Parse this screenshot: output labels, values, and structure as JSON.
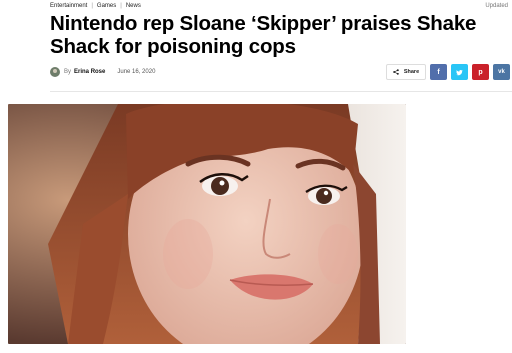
{
  "breadcrumb": [
    "Entertainment",
    "Games",
    "News"
  ],
  "updated_label": "Updated",
  "headline": "Nintendo rep Sloane ‘Skipper’ praises Shake Shack for poisoning cops",
  "byline": {
    "by": "By",
    "author": "Erina Rose",
    "date": "June 16, 2020"
  },
  "share": {
    "label": "Share",
    "networks": [
      {
        "name": "facebook",
        "glyph": "f"
      },
      {
        "name": "twitter",
        "glyph": "t"
      },
      {
        "name": "pinterest",
        "glyph": "p"
      },
      {
        "name": "vk",
        "glyph": "vk"
      }
    ]
  },
  "colors": {
    "facebook": "#516eab",
    "twitter": "#29c5f6",
    "pinterest": "#ca212a",
    "vk": "#4c75a3"
  },
  "hero_image": {
    "icon": "portrait-photo"
  }
}
